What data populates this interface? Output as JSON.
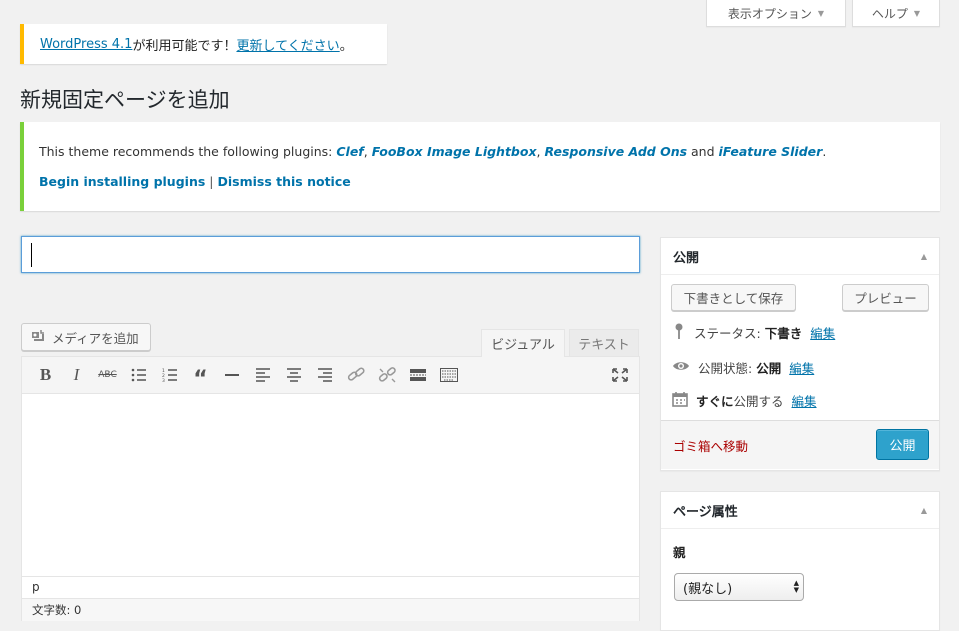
{
  "header_tabs": {
    "screen_options": "表示オプション",
    "help": "ヘルプ"
  },
  "update_nag": {
    "link1": "WordPress 4.1",
    "middle": " が利用可能です！",
    "link2": "更新してください",
    "end": "。"
  },
  "page_title": "新規固定ページを追加",
  "plugin_notice": {
    "prefix": "This theme recommends the following plugins: ",
    "plugins": [
      "Clef",
      "FooBox Image Lightbox",
      "Responsive Add Ons",
      "iFeature Slider"
    ],
    "comma": ", ",
    "and": " and ",
    "period": ".",
    "begin_link": "Begin installing plugins",
    "separator": "|",
    "dismiss_link": "Dismiss this notice"
  },
  "title_field": {
    "value": ""
  },
  "editor": {
    "add_media_label": "メディアを追加",
    "tab_visual": "ビジュアル",
    "tab_text": "テキスト",
    "path": "p",
    "word_count": "文字数: 0"
  },
  "publish_box": {
    "title": "公開",
    "save_draft": "下書きとして保存",
    "preview": "プレビュー",
    "status_label": "ステータス: ",
    "status_value": "下書き",
    "visibility_label": "公開状態: ",
    "visibility_value": "公開",
    "schedule_label": "すぐに",
    "schedule_value": "公開する",
    "edit": "編集",
    "trash": "ゴミ箱へ移動",
    "publish": "公開"
  },
  "page_attributes": {
    "title": "ページ属性",
    "parent_label": "親",
    "parent_selected": "(親なし)"
  },
  "colors": {
    "accent": "#0073aa",
    "publish_button": "#2ea2cc",
    "update_nag_border": "#ffba00",
    "notice_border": "#7ad03a",
    "trash": "#aa0000"
  }
}
